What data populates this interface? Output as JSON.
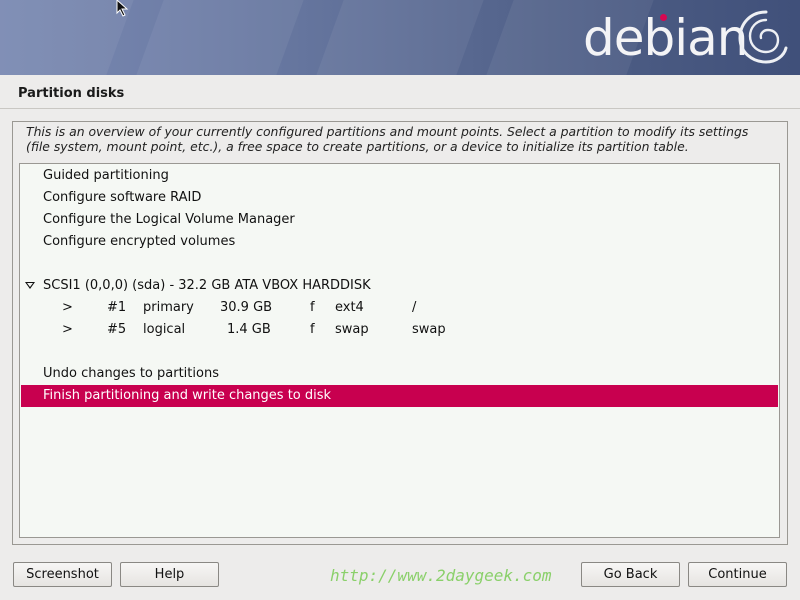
{
  "banner": {
    "logo_text": "debian",
    "colors": {
      "accent_dot": "#d70751",
      "banner_start": "#7a89b2",
      "banner_end": "#40507a"
    }
  },
  "page": {
    "title": "Partition disks",
    "description": "This is an overview of your currently configured partitions and mount points. Select a partition to modify its settings (file system, mount point, etc.), a free space to create partitions, or a device to initialize its partition table."
  },
  "menu": {
    "guided": "Guided partitioning",
    "raid": "Configure software RAID",
    "lvm": "Configure the Logical Volume Manager",
    "encrypted": "Configure encrypted volumes",
    "disk": "SCSI1 (0,0,0) (sda) - 32.2 GB ATA VBOX HARDDISK",
    "undo": "Undo changes to partitions",
    "finish": "Finish partitioning and write changes to disk"
  },
  "partitions": [
    {
      "arrow": ">",
      "number": "#1",
      "type": "primary",
      "size": "30.9 GB",
      "flag": "f",
      "fs": "ext4",
      "mount": "/"
    },
    {
      "arrow": ">",
      "number": "#5",
      "type": "logical",
      "size": "1.4 GB",
      "flag": "f",
      "fs": "swap",
      "mount": "swap"
    }
  ],
  "selection_color": "#c8004f",
  "buttons": {
    "screenshot": "Screenshot",
    "help": "Help",
    "go_back": "Go Back",
    "continue": "Continue"
  },
  "watermark": "http://www.2daygeek.com"
}
